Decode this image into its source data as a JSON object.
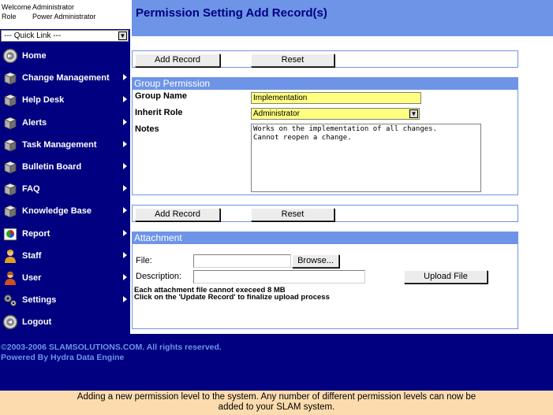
{
  "user": {
    "welcome_label": "Welcome",
    "welcome_value": "Administrator",
    "role_label": "Role",
    "role_value": "Power Administrator"
  },
  "quick_link": {
    "value": "--- Quick Link ---"
  },
  "sidebar": {
    "items": [
      {
        "label": "Home",
        "icon": "home-icon",
        "has_submenu": false
      },
      {
        "label": "Change Management",
        "icon": "cube-icon",
        "has_submenu": true
      },
      {
        "label": "Help Desk",
        "icon": "cube-icon",
        "has_submenu": true
      },
      {
        "label": "Alerts",
        "icon": "cube-icon",
        "has_submenu": true
      },
      {
        "label": "Task Management",
        "icon": "cube-icon",
        "has_submenu": true
      },
      {
        "label": "Bulletin Board",
        "icon": "cube-icon",
        "has_submenu": true
      },
      {
        "label": "FAQ",
        "icon": "cube-icon",
        "has_submenu": true
      },
      {
        "label": "Knowledge Base",
        "icon": "cube-icon",
        "has_submenu": true
      },
      {
        "label": "Report",
        "icon": "report-icon",
        "has_submenu": true
      },
      {
        "label": "Staff",
        "icon": "staff-icon",
        "has_submenu": true
      },
      {
        "label": "User",
        "icon": "user-icon",
        "has_submenu": true
      },
      {
        "label": "Settings",
        "icon": "gears-icon",
        "has_submenu": true
      },
      {
        "label": "Logout",
        "icon": "logout-icon",
        "has_submenu": false
      }
    ]
  },
  "page": {
    "title": "Permission Setting Add Record(s)"
  },
  "toolbar": {
    "add_label": "Add Record",
    "reset_label": "Reset"
  },
  "group_permission": {
    "header": "Group Permission",
    "group_name_label": "Group Name",
    "group_name_value": "Implementation",
    "inherit_role_label": "Inherit Role",
    "inherit_role_value": "Administrator",
    "notes_label": "Notes",
    "notes_value": "Works on the implementation of all changes.\nCannot reopen a change."
  },
  "attachment": {
    "header": "Attachment",
    "file_label": "File:",
    "browse_label": "Browse...",
    "description_label": "Description:",
    "upload_label": "Upload File",
    "note1": "Each attachment file cannot execeed 8 MB",
    "note2": "Click on the 'Update Record' to finalize upload process"
  },
  "footer": {
    "copyright": "©2003-2006 SLAMSOLUTIONS.COM. All rights reserved.",
    "powered": "Powered By Hydra Data Engine"
  },
  "caption": {
    "line1": "Adding a new permission level to the system. Any number of different permission levels can now be",
    "line2": "added to your SLAM system."
  },
  "colors": {
    "navy": "#000080",
    "panel_blue": "#6e94e8",
    "input_yellow": "#ffff80",
    "caption_bg": "#fcdcae"
  }
}
